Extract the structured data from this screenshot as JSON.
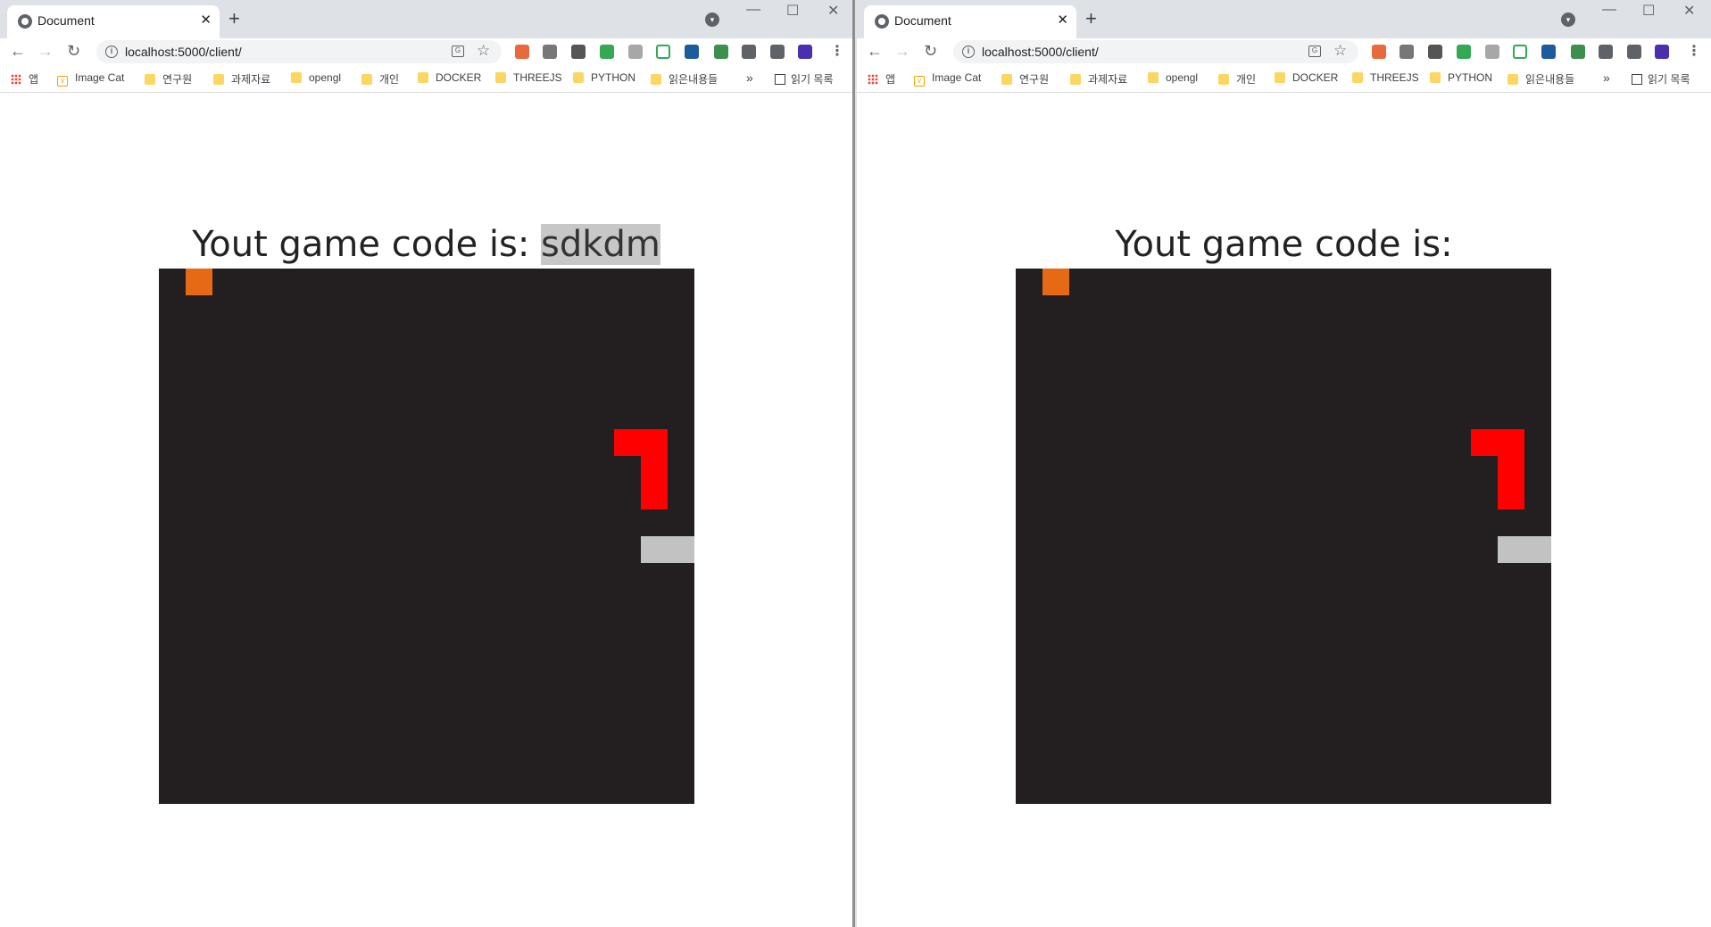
{
  "browser": {
    "tab_title": "Document",
    "url": "localhost:5000/client/",
    "bookmarks": [
      "앱",
      "Image Cat",
      "연구원",
      "과제자료",
      "opengl",
      "개인",
      "DOCKER",
      "THREEJS",
      "PYTHON",
      "읽은내용들"
    ],
    "reading_list": "읽기 목록",
    "more": "»"
  },
  "left_window": {
    "heading": "Yout game code is: ",
    "game_code": "sdkdm",
    "game_code_selected": true
  },
  "right_window": {
    "heading": "Yout game code is: ",
    "game_code": ""
  },
  "game": {
    "grid_size": 20,
    "background_color": "#231f20",
    "food_color": "#e66916",
    "player1_color": "#ff0000",
    "player2_color": "#c2c2c2",
    "food": [
      [
        1,
        0
      ]
    ],
    "player1_snake": [
      [
        17,
        6
      ],
      [
        18,
        6
      ],
      [
        18,
        7
      ],
      [
        18,
        8
      ]
    ],
    "player2_snake": [
      [
        18,
        10
      ],
      [
        19,
        10
      ]
    ]
  },
  "colors": {
    "tabbar": "#dee1e6",
    "omnibox": "#f1f3f4"
  }
}
